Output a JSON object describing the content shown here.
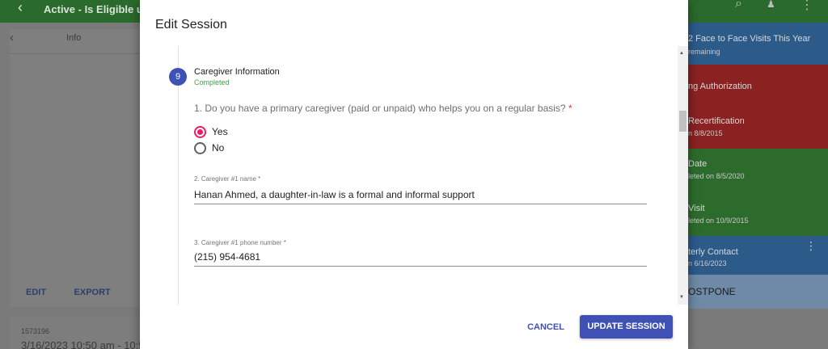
{
  "app": {
    "title": "Active - Is Eligible un",
    "back_icon": "‹",
    "search_icon": "search-icon",
    "bell_icon": "bell-icon",
    "more_icon": "more-vertical-icon"
  },
  "left_panel": {
    "title": "Info",
    "edit_label": "EDIT",
    "export_label": "EXPORT"
  },
  "left_card": {
    "id": "1573196",
    "date": "3/16/2023 10:50 am - 10:5"
  },
  "right_list": [
    {
      "title": "2 Face to Face Visits This Year",
      "sub": "remaining",
      "color": "#2c5b8a"
    },
    {
      "title": "ng Authorization",
      "sub": "",
      "color": "#8a2222"
    },
    {
      "title": "Recertification",
      "sub": "n 8/8/2015",
      "color": "#8a2222"
    },
    {
      "title": "Date",
      "sub": "leted on 8/5/2020",
      "color": "#2d6b2d"
    },
    {
      "title": " Visit",
      "sub": "leted on 10/9/2015",
      "color": "#2d6b2d"
    },
    {
      "title": "terly Contact",
      "sub": "n 6/16/2023",
      "color": "#2c5b8a"
    },
    {
      "title": "OSTPONE",
      "sub": "",
      "color": "#6e8aa6"
    }
  ],
  "modal": {
    "title": "Edit Session",
    "step": {
      "number": "9",
      "title": "Caregiver Information",
      "status": "Completed"
    },
    "question1": {
      "text": "1. Do you have a primary caregiver (paid or unpaid) who helps you on a regular basis?",
      "required_mark": "*",
      "options": [
        "Yes",
        "No"
      ],
      "selected": "Yes"
    },
    "field2": {
      "label": "2. Caregiver #1 name *",
      "value": "Hanan Ahmed, a daughter-in-law is a formal and informal support"
    },
    "field3": {
      "label": "3. Caregiver #1 phone number *",
      "value": "(215) 954-4681"
    },
    "cancel_label": "CANCEL",
    "update_label": "UPDATE SESSION"
  },
  "colors": {
    "primary": "#3f51b5",
    "radio_selected": "#e91e63",
    "status_green": "#43a047",
    "app_bar_green": "#2a6a2c"
  }
}
